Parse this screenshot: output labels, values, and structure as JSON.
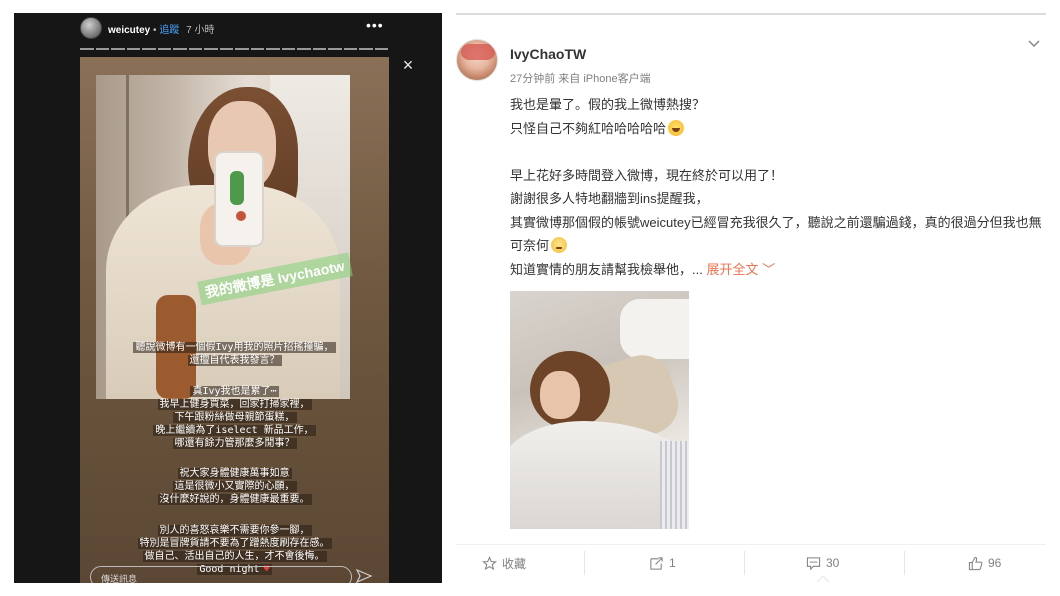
{
  "story": {
    "username": "weicutey",
    "dot": "•",
    "follow_label": "追蹤",
    "time": "7 小時",
    "more_label": "•••",
    "close_label": "×",
    "sticker": "我的微博是 Ivychaotw",
    "text_block_1": [
      "聽說微博有一個假Ivy用我的照片招搖撞騙，",
      "還擅自代表我發言？"
    ],
    "text_block_2": [
      "真Ivy我也是累了⋯",
      "我早上健身買菜，回家打掃家裡，",
      "下午跟粉絲做母親節蛋糕，",
      "晚上繼續為了iselect 新品工作，",
      "哪還有餘力管那麼多閒事？"
    ],
    "text_block_3": [
      "祝大家身體健康萬事如意",
      "這是很微小又實際的心願，",
      "沒什麼好說的，身體健康最重要。"
    ],
    "text_block_4": [
      "別人的喜怒哀樂不需要你參一腳，",
      "特別是冒牌貨請不要為了蹭熱度刷存在感。",
      "做自己、活出自己的人生，才不會後悔。",
      "Good night"
    ],
    "reply_placeholder": "傳送訊息"
  },
  "weibo": {
    "username": "IvyChaoTW",
    "meta": "27分钟前 来自 iPhone客户端",
    "lines": [
      "我也是暈了。假的我上微博熱搜？",
      "只怪自己不夠紅哈哈哈哈哈",
      "早上花好多時間登入微博，現在終於可以用了！",
      "謝謝很多人特地翻牆到ins提醒我，",
      "其實微博那個假的帳號weicutey已經冒充我很久了，聽說之前還騙過錢，真的很過分但我也無可奈何",
      "知道實情的朋友請幫我檢舉他，..."
    ],
    "expand_label": "展开全文",
    "expand_arrow": "﹀",
    "actions": {
      "favorite_label": "收藏",
      "repost_count": "1",
      "comment_count": "30",
      "like_count": "96"
    }
  },
  "colors": {
    "accent": "#eb7350",
    "story_bg": "#161616",
    "weibo_text": "#333333",
    "meta_text": "#808080"
  },
  "icons": {
    "star": "star-icon",
    "repost": "repost-icon",
    "comment": "comment-icon",
    "like": "thumbs-up-icon",
    "send": "send-icon",
    "close": "close-icon",
    "more": "more-icon",
    "chevron": "chevron-down-icon"
  }
}
